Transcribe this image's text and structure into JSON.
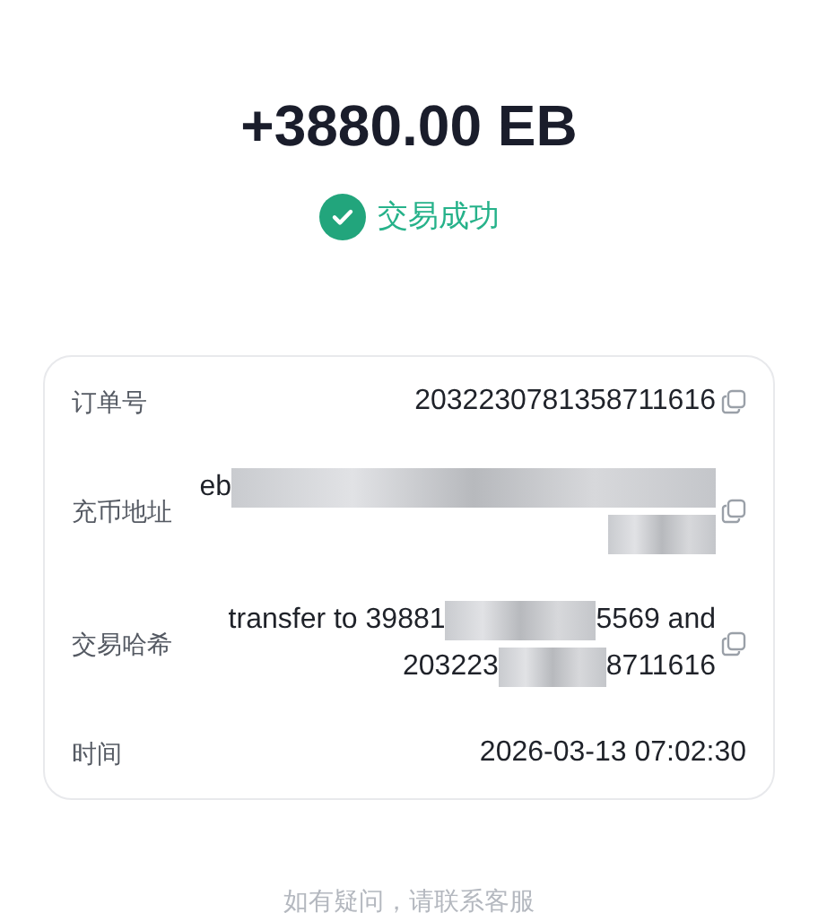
{
  "amount": "+3880.00 EB",
  "status": {
    "kind": "success",
    "label": "交易成功"
  },
  "details": [
    {
      "label": "订单号",
      "lines": [
        [
          {
            "kind": "text",
            "text": "2032230781358711616"
          }
        ]
      ],
      "copyable": true
    },
    {
      "label": "充币地址",
      "lines": [
        [
          {
            "kind": "text",
            "text": "eb"
          },
          {
            "kind": "redacted"
          }
        ],
        [
          {
            "kind": "redacted"
          }
        ]
      ],
      "copyable": true
    },
    {
      "label": "交易哈希",
      "lines": [
        [
          {
            "kind": "text",
            "text": "transfer to 39881"
          },
          {
            "kind": "redacted"
          },
          {
            "kind": "text",
            "text": "5569 and"
          }
        ],
        [
          {
            "kind": "text",
            "text": "203223"
          },
          {
            "kind": "redacted"
          },
          {
            "kind": "text",
            "text": "8711616"
          }
        ]
      ],
      "copyable": true
    },
    {
      "label": "时间",
      "lines": [
        [
          {
            "kind": "text",
            "text": "2026-03-13 07:02:30"
          }
        ]
      ],
      "copyable": false
    }
  ],
  "footer": "如有疑问，请联系客服"
}
